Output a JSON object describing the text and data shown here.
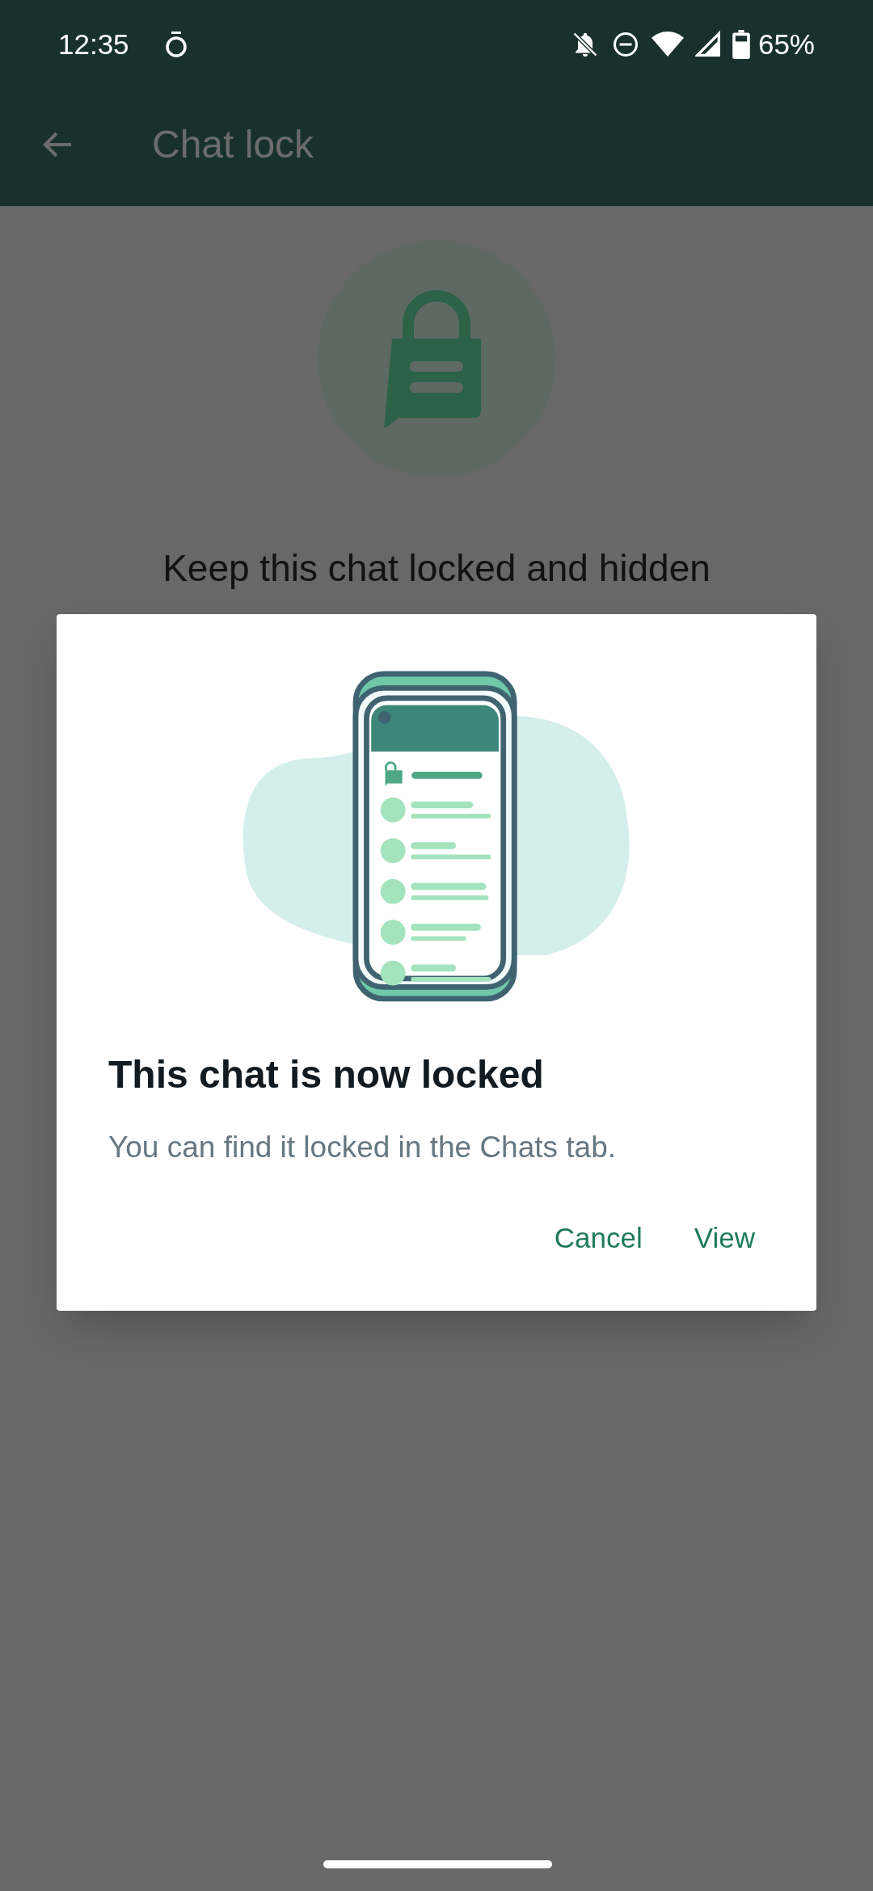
{
  "status_bar": {
    "time": "12:35",
    "battery": "65%"
  },
  "app_bar": {
    "title": "Chat lock"
  },
  "page": {
    "heading": "Keep this chat locked and hidden"
  },
  "dialog": {
    "title": "This chat is now locked",
    "message": "You can find it locked in the Chats tab.",
    "buttons": [
      "Cancel",
      "View"
    ]
  }
}
